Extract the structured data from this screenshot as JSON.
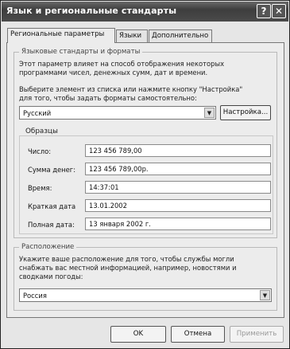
{
  "window": {
    "title": "Язык и региональные стандарты",
    "help_label": "?",
    "close_label": "✕"
  },
  "tabs": [
    {
      "label": "Региональные параметры",
      "active": true
    },
    {
      "label": "Языки",
      "active": false
    },
    {
      "label": "Дополнительно",
      "active": false
    }
  ],
  "standards": {
    "group_label": "Языковые стандарты и форматы",
    "description_line1": "Этот параметр влияет на способ отображения некоторых",
    "description_line2": "программами чисел, денежных сумм, дат и времени.",
    "select_prompt_line1": "Выберите элемент из списка или нажмите кнопку \"Настройка\"",
    "select_prompt_line2": "для того, чтобы задать форматы самостоятельно:",
    "selected_locale": "Русский",
    "customize_button": "Настройка..."
  },
  "samples": {
    "label": "Образцы",
    "rows": [
      {
        "label": "Число:",
        "value": "123 456 789,00"
      },
      {
        "label": "Сумма денег:",
        "value": "123 456 789,00р."
      },
      {
        "label": "Время:",
        "value": "14:37:01"
      },
      {
        "label": "Краткая дата",
        "value": "13.01.2002"
      },
      {
        "label": "Полная дата:",
        "value": "13 января 2002 г."
      }
    ]
  },
  "location": {
    "group_label": "Расположение",
    "description_line1": "Укажите ваше расположение для того, чтобы службы могли",
    "description_line2": "снабжать вас местной информацией, например, новостями и",
    "description_line3": "сводками погоды:",
    "selected_country": "Россия"
  },
  "footer": {
    "ok_label": "OK",
    "cancel_label": "Отмена",
    "apply_label": "Применить"
  }
}
